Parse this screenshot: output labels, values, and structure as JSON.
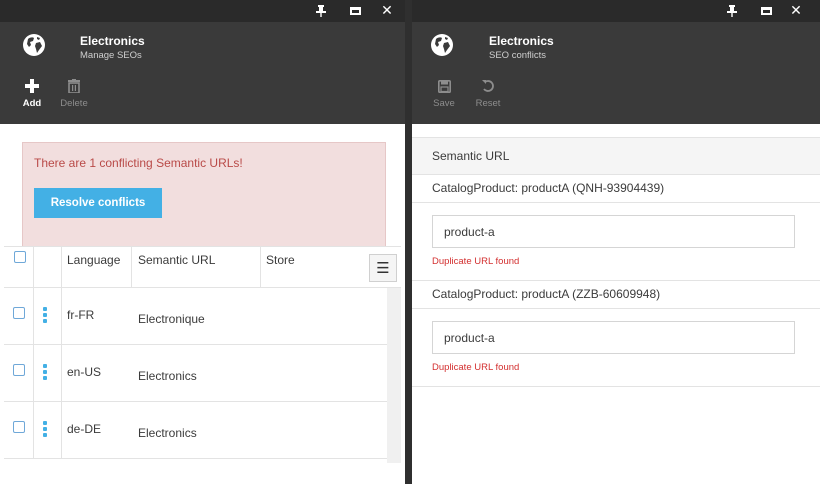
{
  "left_blade": {
    "title": "Electronics",
    "subtitle": "Manage SEOs",
    "toolbar": {
      "add_label": "Add",
      "delete_label": "Delete"
    },
    "alert": {
      "message": "There are 1 conflicting Semantic URLs!",
      "resolve_label": "Resolve conflicts"
    },
    "grid": {
      "headers": [
        "Language",
        "Semantic URL",
        "Store"
      ],
      "rows": [
        {
          "language": "fr-FR",
          "semantic_url": "Electronique",
          "store": ""
        },
        {
          "language": "en-US",
          "semantic_url": "Electronics",
          "store": ""
        },
        {
          "language": "de-DE",
          "semantic_url": "Electronics",
          "store": ""
        }
      ]
    }
  },
  "right_blade": {
    "title": "Electronics",
    "subtitle": "SEO conflicts",
    "toolbar": {
      "save_label": "Save",
      "reset_label": "Reset"
    },
    "section_title": "Semantic URL",
    "conflicts": [
      {
        "title": "CatalogProduct: productA (QNH-93904439)",
        "value": "product-a",
        "error": "Duplicate URL found"
      },
      {
        "title": "CatalogProduct: productA (ZZB-60609948)",
        "value": "product-a",
        "error": "Duplicate URL found"
      }
    ]
  },
  "colors": {
    "accent": "#43b0e5",
    "alert_bg": "#f2dede",
    "alert_text": "#b94a48",
    "error_text": "#d32f2f",
    "header_bg": "#3a3a3a"
  },
  "icons": {
    "pin": "pin-icon",
    "maximize": "maximize-icon",
    "close": "close-icon",
    "globe": "globe-icon",
    "add": "plus-icon",
    "delete": "trash-icon",
    "save": "save-icon",
    "reset": "undo-icon",
    "grid_menu": "hamburger-menu-icon",
    "row_menu": "kebab-menu-icon"
  }
}
